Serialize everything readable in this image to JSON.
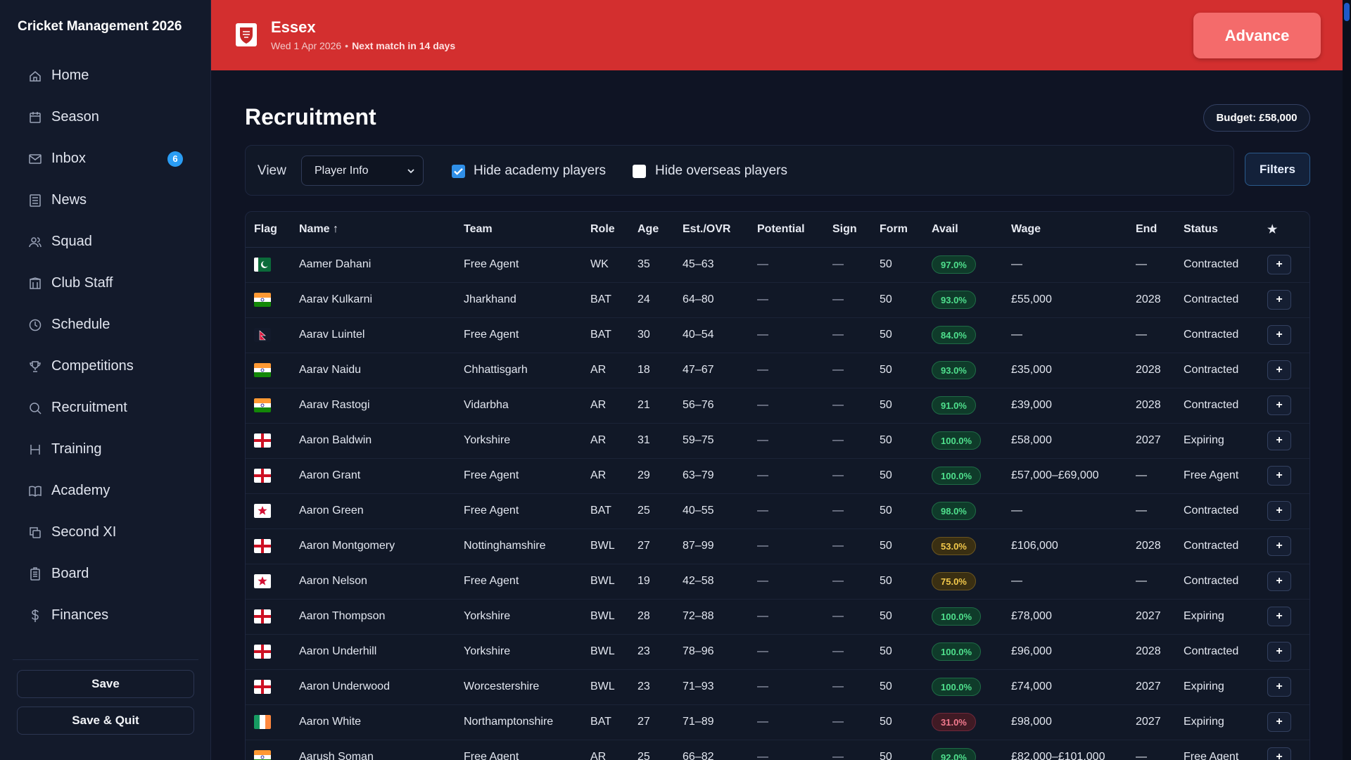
{
  "app": {
    "title": "Cricket Management 2026"
  },
  "sidebar": {
    "items": [
      {
        "label": "Home",
        "icon": "home-icon"
      },
      {
        "label": "Season",
        "icon": "calendar-icon"
      },
      {
        "label": "Inbox",
        "icon": "mail-icon",
        "badge": "6"
      },
      {
        "label": "News",
        "icon": "newspaper-icon"
      },
      {
        "label": "Squad",
        "icon": "users-icon"
      },
      {
        "label": "Club Staff",
        "icon": "building-icon"
      },
      {
        "label": "Schedule",
        "icon": "clock-icon"
      },
      {
        "label": "Competitions",
        "icon": "trophy-icon"
      },
      {
        "label": "Recruitment",
        "icon": "search-icon"
      },
      {
        "label": "Training",
        "icon": "dumbbell-icon"
      },
      {
        "label": "Academy",
        "icon": "book-icon"
      },
      {
        "label": "Second XI",
        "icon": "copy-icon"
      },
      {
        "label": "Board",
        "icon": "clipboard-icon"
      },
      {
        "label": "Finances",
        "icon": "dollar-icon"
      }
    ],
    "save_label": "Save",
    "save_quit_label": "Save & Quit"
  },
  "header": {
    "team": "Essex",
    "date": "Wed 1 Apr 2026",
    "separator": "•",
    "next_match": "Next match in 14 days",
    "advance_label": "Advance",
    "accent_color": "#d32f2f"
  },
  "page": {
    "title": "Recruitment",
    "budget": "Budget: £58,000"
  },
  "toolbar": {
    "view_label": "View",
    "view_selected": "Player Info",
    "hide_academy_label": "Hide academy players",
    "hide_academy_checked": true,
    "hide_overseas_label": "Hide overseas players",
    "hide_overseas_checked": false,
    "filters_label": "Filters"
  },
  "table": {
    "columns": [
      "Flag",
      "Name ↑",
      "Team",
      "Role",
      "Age",
      "Est./OVR",
      "Potential",
      "Sign",
      "Form",
      "Avail",
      "Wage",
      "End",
      "Status",
      "★"
    ],
    "add_label": "+",
    "rows": [
      {
        "flag": "pakistan",
        "name": "Aamer Dahani",
        "team": "Free Agent",
        "role": "WK",
        "age": "35",
        "ovr": "45–63",
        "potential": "—",
        "sign": "—",
        "form": "50",
        "avail": "97.0%",
        "avail_level": "g",
        "wage": "—",
        "end": "—",
        "status": "Contracted"
      },
      {
        "flag": "india",
        "name": "Aarav Kulkarni",
        "team": "Jharkhand",
        "role": "BAT",
        "age": "24",
        "ovr": "64–80",
        "potential": "—",
        "sign": "—",
        "form": "50",
        "avail": "93.0%",
        "avail_level": "g",
        "wage": "£55,000",
        "end": "2028",
        "status": "Contracted"
      },
      {
        "flag": "nepal",
        "name": "Aarav Luintel",
        "team": "Free Agent",
        "role": "BAT",
        "age": "30",
        "ovr": "40–54",
        "potential": "—",
        "sign": "—",
        "form": "50",
        "avail": "84.0%",
        "avail_level": "g",
        "wage": "—",
        "end": "—",
        "status": "Contracted"
      },
      {
        "flag": "india",
        "name": "Aarav Naidu",
        "team": "Chhattisgarh",
        "role": "AR",
        "age": "18",
        "ovr": "47–67",
        "potential": "—",
        "sign": "—",
        "form": "50",
        "avail": "93.0%",
        "avail_level": "g",
        "wage": "£35,000",
        "end": "2028",
        "status": "Contracted"
      },
      {
        "flag": "india",
        "name": "Aarav Rastogi",
        "team": "Vidarbha",
        "role": "AR",
        "age": "21",
        "ovr": "56–76",
        "potential": "—",
        "sign": "—",
        "form": "50",
        "avail": "91.0%",
        "avail_level": "g",
        "wage": "£39,000",
        "end": "2028",
        "status": "Contracted"
      },
      {
        "flag": "england",
        "name": "Aaron Baldwin",
        "team": "Yorkshire",
        "role": "AR",
        "age": "31",
        "ovr": "59–75",
        "potential": "—",
        "sign": "—",
        "form": "50",
        "avail": "100.0%",
        "avail_level": "g",
        "wage": "£58,000",
        "end": "2027",
        "status": "Expiring"
      },
      {
        "flag": "england",
        "name": "Aaron Grant",
        "team": "Free Agent",
        "role": "AR",
        "age": "29",
        "ovr": "63–79",
        "potential": "—",
        "sign": "—",
        "form": "50",
        "avail": "100.0%",
        "avail_level": "g",
        "wage": "£57,000–£69,000",
        "end": "—",
        "status": "Free Agent"
      },
      {
        "flag": "wales",
        "name": "Aaron Green",
        "team": "Free Agent",
        "role": "BAT",
        "age": "25",
        "ovr": "40–55",
        "potential": "—",
        "sign": "—",
        "form": "50",
        "avail": "98.0%",
        "avail_level": "g",
        "wage": "—",
        "end": "—",
        "status": "Contracted"
      },
      {
        "flag": "england",
        "name": "Aaron Montgomery",
        "team": "Nottinghamshire",
        "role": "BWL",
        "age": "27",
        "ovr": "87–99",
        "potential": "—",
        "sign": "—",
        "form": "50",
        "avail": "53.0%",
        "avail_level": "y",
        "wage": "£106,000",
        "end": "2028",
        "status": "Contracted"
      },
      {
        "flag": "wales",
        "name": "Aaron Nelson",
        "team": "Free Agent",
        "role": "BWL",
        "age": "19",
        "ovr": "42–58",
        "potential": "—",
        "sign": "—",
        "form": "50",
        "avail": "75.0%",
        "avail_level": "y",
        "wage": "—",
        "end": "—",
        "status": "Contracted"
      },
      {
        "flag": "england",
        "name": "Aaron Thompson",
        "team": "Yorkshire",
        "role": "BWL",
        "age": "28",
        "ovr": "72–88",
        "potential": "—",
        "sign": "—",
        "form": "50",
        "avail": "100.0%",
        "avail_level": "g",
        "wage": "£78,000",
        "end": "2027",
        "status": "Expiring"
      },
      {
        "flag": "england",
        "name": "Aaron Underhill",
        "team": "Yorkshire",
        "role": "BWL",
        "age": "23",
        "ovr": "78–96",
        "potential": "—",
        "sign": "—",
        "form": "50",
        "avail": "100.0%",
        "avail_level": "g",
        "wage": "£96,000",
        "end": "2028",
        "status": "Contracted"
      },
      {
        "flag": "england",
        "name": "Aaron Underwood",
        "team": "Worcestershire",
        "role": "BWL",
        "age": "23",
        "ovr": "71–93",
        "potential": "—",
        "sign": "—",
        "form": "50",
        "avail": "100.0%",
        "avail_level": "g",
        "wage": "£74,000",
        "end": "2027",
        "status": "Expiring"
      },
      {
        "flag": "ireland",
        "name": "Aaron White",
        "team": "Northamptonshire",
        "role": "BAT",
        "age": "27",
        "ovr": "71–89",
        "potential": "—",
        "sign": "—",
        "form": "50",
        "avail": "31.0%",
        "avail_level": "r",
        "wage": "£98,000",
        "end": "2027",
        "status": "Expiring"
      },
      {
        "flag": "india",
        "name": "Aarush Soman",
        "team": "Free Agent",
        "role": "AR",
        "age": "25",
        "ovr": "66–82",
        "potential": "—",
        "sign": "—",
        "form": "50",
        "avail": "92.0%",
        "avail_level": "g",
        "wage": "£82,000–£101,000",
        "end": "—",
        "status": "Free Agent"
      }
    ]
  }
}
